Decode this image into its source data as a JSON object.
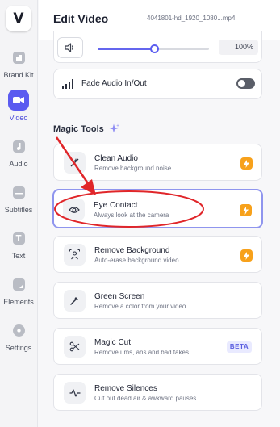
{
  "sidebar": {
    "logo": "V",
    "items": [
      {
        "label": "Brand Kit",
        "icon": "brand-kit-icon"
      },
      {
        "label": "Video",
        "icon": "video-camera-icon",
        "active": true
      },
      {
        "label": "Audio",
        "icon": "music-note-icon"
      },
      {
        "label": "Subtitles",
        "icon": "subtitles-icon"
      },
      {
        "label": "Text",
        "icon": "text-t-icon"
      },
      {
        "label": "Elements",
        "icon": "elements-icon"
      },
      {
        "label": "Settings",
        "icon": "settings-icon"
      }
    ]
  },
  "header": {
    "title": "Edit Video",
    "filename": "4041801-hd_1920_1080...mp4"
  },
  "audio": {
    "volume_value": "100%",
    "volume_level": 0.51,
    "fade_label": "Fade Audio In/Out",
    "fade_enabled": false
  },
  "magic_tools": {
    "title": "Magic Tools",
    "items": [
      {
        "name": "Clean Audio",
        "desc": "Remove background noise",
        "icon": "clean-audio-icon",
        "badge": "bolt"
      },
      {
        "name": "Eye Contact",
        "desc": "Always look at the camera",
        "icon": "eye-icon",
        "badge": "bolt",
        "selected": true
      },
      {
        "name": "Remove Background",
        "desc": "Auto-erase background video",
        "icon": "person-cutout-icon",
        "badge": "bolt"
      },
      {
        "name": "Green Screen",
        "desc": "Remove a color from your video",
        "icon": "eyedropper-icon"
      },
      {
        "name": "Magic Cut",
        "desc": "Remove ums, ahs and bad takes",
        "icon": "scissors-icon",
        "badge": "BETA"
      },
      {
        "name": "Remove Silences",
        "desc": "Cut out dead air & awkward pauses",
        "icon": "waveform-icon"
      }
    ]
  },
  "colors": {
    "accent": "#5b5bf0",
    "badge_orange": "#f7a11b",
    "annotation_red": "#e0262a",
    "selected_border": "#8f95ee"
  }
}
